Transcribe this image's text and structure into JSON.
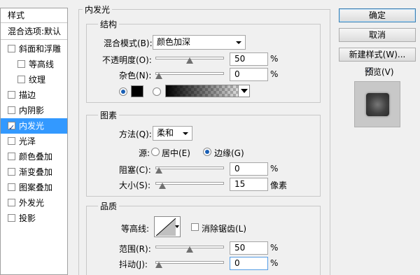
{
  "style_list": {
    "header": "样式",
    "blend_options": "混合选项:默认",
    "items": [
      {
        "label": "斜面和浮雕",
        "checked": false
      },
      {
        "label": "等高线",
        "checked": false
      },
      {
        "label": "纹理",
        "checked": false
      },
      {
        "label": "描边",
        "checked": false
      },
      {
        "label": "内阴影",
        "checked": false
      },
      {
        "label": "内发光",
        "checked": true
      },
      {
        "label": "光泽",
        "checked": false
      },
      {
        "label": "颜色叠加",
        "checked": false
      },
      {
        "label": "渐变叠加",
        "checked": false
      },
      {
        "label": "图案叠加",
        "checked": false
      },
      {
        "label": "外发光",
        "checked": false
      },
      {
        "label": "投影",
        "checked": false
      }
    ]
  },
  "panel": {
    "title": "内发光",
    "structure": {
      "title": "结构",
      "blend_mode_label": "混合模式(B):",
      "blend_mode_value": "颜色加深",
      "opacity_label": "不透明度(O):",
      "opacity_value": "50",
      "opacity_level": 50,
      "opacity_unit": "%",
      "noise_label": "杂色(N):",
      "noise_value": "0",
      "noise_level": 0,
      "noise_unit": "%",
      "color_mode": "solid",
      "color_hex": "#000000"
    },
    "elements": {
      "title": "图素",
      "method_label": "方法(Q):",
      "method_value": "柔和",
      "source_label": "源:",
      "source_center": "居中(E)",
      "source_edge": "边缘(G)",
      "choke_label": "阻塞(C):",
      "choke_value": "0",
      "choke_level": 0,
      "choke_unit": "%",
      "size_label": "大小(S):",
      "size_value": "15",
      "size_level": 6,
      "size_unit": "像素"
    },
    "quality": {
      "title": "品质",
      "contour_label": "等高线:",
      "anti_alias_label": "消除锯齿(L)",
      "range_label": "范围(R):",
      "range_value": "50",
      "range_level": 50,
      "range_unit": "%",
      "jitter_label": "抖动(J):",
      "jitter_value": "0",
      "jitter_level": 0,
      "jitter_unit": "%"
    }
  },
  "buttons": {
    "ok": "确定",
    "cancel": "取消",
    "new_style": "新建样式(W)...",
    "preview_label": "预览(V)"
  },
  "colors": {
    "selected_bg": "#3399ff",
    "panel_bg": "#f0f0f0"
  }
}
